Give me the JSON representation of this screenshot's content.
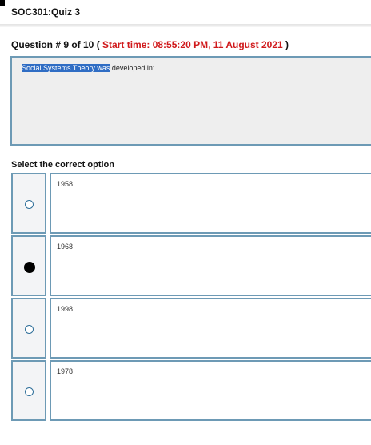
{
  "quiz": {
    "title": "SOC301:Quiz 3"
  },
  "question": {
    "header_prefix": "Question # 9 of 10 ( ",
    "start_time": "Start time: 08:55:20 PM, 11 August 2021",
    "header_suffix": " )",
    "text_highlighted": "Social Systems Theory was",
    "text_rest": " developed in:"
  },
  "answers": {
    "label": "Select the correct option",
    "selected_index": 1,
    "options": [
      {
        "label": "1958",
        "selected": false
      },
      {
        "label": "1968",
        "selected": true
      },
      {
        "label": "1998",
        "selected": false
      },
      {
        "label": "1978",
        "selected": false
      }
    ]
  },
  "colors": {
    "start_time": "#d0191b",
    "border": "#6d9ab5",
    "selection_highlight": "#2f6dc4",
    "radio_border": "#2f6f9a"
  }
}
